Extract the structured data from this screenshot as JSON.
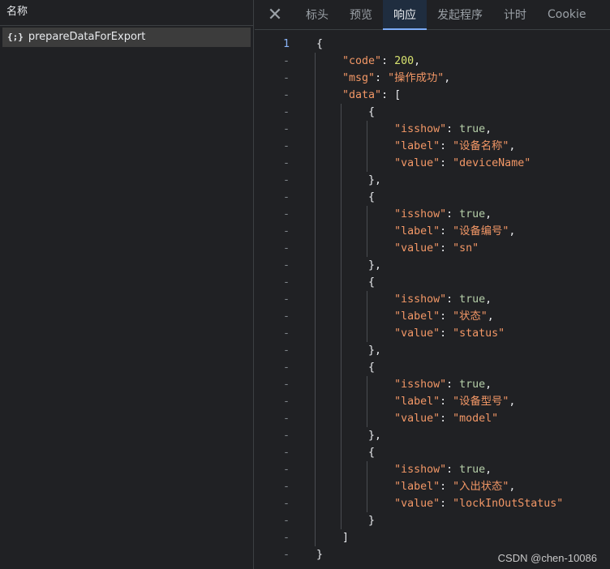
{
  "left": {
    "header": "名称",
    "request": {
      "icon_text": "{;}",
      "name": "prepareDataForExport"
    }
  },
  "tabs": [
    {
      "label": "标头",
      "active": false
    },
    {
      "label": "预览",
      "active": false
    },
    {
      "label": "响应",
      "active": true
    },
    {
      "label": "发起程序",
      "active": false
    },
    {
      "label": "计时",
      "active": false
    },
    {
      "label": "Cookie",
      "active": false
    }
  ],
  "close_glyph": "✕",
  "gutter": {
    "first": "1",
    "rest": "-"
  },
  "code_lines": [
    [
      {
        "t": "{",
        "c": "punct"
      }
    ],
    [
      {
        "t": "    ",
        "c": "punct"
      },
      {
        "t": "\"code\"",
        "c": "key"
      },
      {
        "t": ": ",
        "c": "punct"
      },
      {
        "t": "200",
        "c": "num"
      },
      {
        "t": ",",
        "c": "punct"
      }
    ],
    [
      {
        "t": "    ",
        "c": "punct"
      },
      {
        "t": "\"msg\"",
        "c": "key"
      },
      {
        "t": ": ",
        "c": "punct"
      },
      {
        "t": "\"操作成功\"",
        "c": "str"
      },
      {
        "t": ",",
        "c": "punct"
      }
    ],
    [
      {
        "t": "    ",
        "c": "punct"
      },
      {
        "t": "\"data\"",
        "c": "key"
      },
      {
        "t": ": [",
        "c": "punct"
      }
    ],
    [
      {
        "t": "        {",
        "c": "punct"
      }
    ],
    [
      {
        "t": "            ",
        "c": "punct"
      },
      {
        "t": "\"isshow\"",
        "c": "key"
      },
      {
        "t": ": ",
        "c": "punct"
      },
      {
        "t": "true",
        "c": "bool"
      },
      {
        "t": ",",
        "c": "punct"
      }
    ],
    [
      {
        "t": "            ",
        "c": "punct"
      },
      {
        "t": "\"label\"",
        "c": "key"
      },
      {
        "t": ": ",
        "c": "punct"
      },
      {
        "t": "\"设备名称\"",
        "c": "str"
      },
      {
        "t": ",",
        "c": "punct"
      }
    ],
    [
      {
        "t": "            ",
        "c": "punct"
      },
      {
        "t": "\"value\"",
        "c": "key"
      },
      {
        "t": ": ",
        "c": "punct"
      },
      {
        "t": "\"deviceName\"",
        "c": "str"
      }
    ],
    [
      {
        "t": "        },",
        "c": "punct"
      }
    ],
    [
      {
        "t": "        {",
        "c": "punct"
      }
    ],
    [
      {
        "t": "            ",
        "c": "punct"
      },
      {
        "t": "\"isshow\"",
        "c": "key"
      },
      {
        "t": ": ",
        "c": "punct"
      },
      {
        "t": "true",
        "c": "bool"
      },
      {
        "t": ",",
        "c": "punct"
      }
    ],
    [
      {
        "t": "            ",
        "c": "punct"
      },
      {
        "t": "\"label\"",
        "c": "key"
      },
      {
        "t": ": ",
        "c": "punct"
      },
      {
        "t": "\"设备编号\"",
        "c": "str"
      },
      {
        "t": ",",
        "c": "punct"
      }
    ],
    [
      {
        "t": "            ",
        "c": "punct"
      },
      {
        "t": "\"value\"",
        "c": "key"
      },
      {
        "t": ": ",
        "c": "punct"
      },
      {
        "t": "\"sn\"",
        "c": "str"
      }
    ],
    [
      {
        "t": "        },",
        "c": "punct"
      }
    ],
    [
      {
        "t": "        {",
        "c": "punct"
      }
    ],
    [
      {
        "t": "            ",
        "c": "punct"
      },
      {
        "t": "\"isshow\"",
        "c": "key"
      },
      {
        "t": ": ",
        "c": "punct"
      },
      {
        "t": "true",
        "c": "bool"
      },
      {
        "t": ",",
        "c": "punct"
      }
    ],
    [
      {
        "t": "            ",
        "c": "punct"
      },
      {
        "t": "\"label\"",
        "c": "key"
      },
      {
        "t": ": ",
        "c": "punct"
      },
      {
        "t": "\"状态\"",
        "c": "str"
      },
      {
        "t": ",",
        "c": "punct"
      }
    ],
    [
      {
        "t": "            ",
        "c": "punct"
      },
      {
        "t": "\"value\"",
        "c": "key"
      },
      {
        "t": ": ",
        "c": "punct"
      },
      {
        "t": "\"status\"",
        "c": "str"
      }
    ],
    [
      {
        "t": "        },",
        "c": "punct"
      }
    ],
    [
      {
        "t": "        {",
        "c": "punct"
      }
    ],
    [
      {
        "t": "            ",
        "c": "punct"
      },
      {
        "t": "\"isshow\"",
        "c": "key"
      },
      {
        "t": ": ",
        "c": "punct"
      },
      {
        "t": "true",
        "c": "bool"
      },
      {
        "t": ",",
        "c": "punct"
      }
    ],
    [
      {
        "t": "            ",
        "c": "punct"
      },
      {
        "t": "\"label\"",
        "c": "key"
      },
      {
        "t": ": ",
        "c": "punct"
      },
      {
        "t": "\"设备型号\"",
        "c": "str"
      },
      {
        "t": ",",
        "c": "punct"
      }
    ],
    [
      {
        "t": "            ",
        "c": "punct"
      },
      {
        "t": "\"value\"",
        "c": "key"
      },
      {
        "t": ": ",
        "c": "punct"
      },
      {
        "t": "\"model\"",
        "c": "str"
      }
    ],
    [
      {
        "t": "        },",
        "c": "punct"
      }
    ],
    [
      {
        "t": "        {",
        "c": "punct"
      }
    ],
    [
      {
        "t": "            ",
        "c": "punct"
      },
      {
        "t": "\"isshow\"",
        "c": "key"
      },
      {
        "t": ": ",
        "c": "punct"
      },
      {
        "t": "true",
        "c": "bool"
      },
      {
        "t": ",",
        "c": "punct"
      }
    ],
    [
      {
        "t": "            ",
        "c": "punct"
      },
      {
        "t": "\"label\"",
        "c": "key"
      },
      {
        "t": ": ",
        "c": "punct"
      },
      {
        "t": "\"入出状态\"",
        "c": "str"
      },
      {
        "t": ",",
        "c": "punct"
      }
    ],
    [
      {
        "t": "            ",
        "c": "punct"
      },
      {
        "t": "\"value\"",
        "c": "key"
      },
      {
        "t": ": ",
        "c": "punct"
      },
      {
        "t": "\"lockInOutStatus\"",
        "c": "str"
      }
    ],
    [
      {
        "t": "        }",
        "c": "punct"
      }
    ],
    [
      {
        "t": "    ]",
        "c": "punct"
      }
    ],
    [
      {
        "t": "}",
        "c": "punct"
      }
    ]
  ],
  "colors": {
    "key": "#f29766",
    "number": "#d7e26f",
    "boolean": "#b5cea8",
    "active_tab_underline": "#7cacf8"
  },
  "watermark": "CSDN @chen-10086"
}
